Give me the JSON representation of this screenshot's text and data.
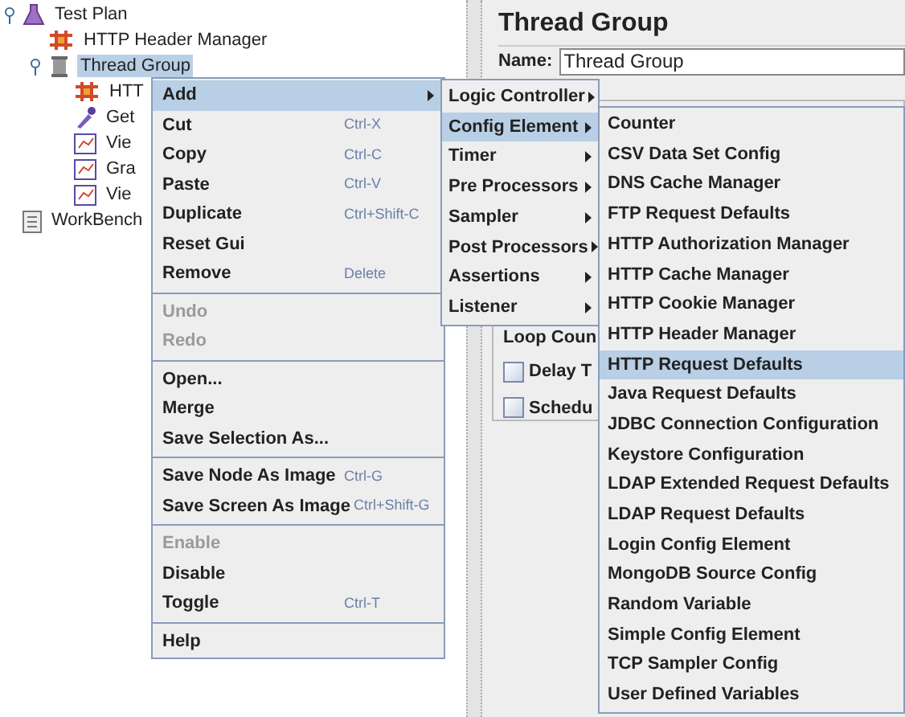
{
  "tree": [
    {
      "label": "Test Plan",
      "kind": "test-plan",
      "expanded": true,
      "selected": false,
      "children": [
        {
          "label": "HTTP Header Manager",
          "kind": "config",
          "selected": false
        },
        {
          "label": "Thread Group",
          "kind": "thread-group",
          "expanded": true,
          "selected": true,
          "children": [
            {
              "label": "HTT",
              "kind": "config",
              "selected": false
            },
            {
              "label": "Get",
              "kind": "sampler",
              "selected": false
            },
            {
              "label": "Vie",
              "kind": "listener",
              "selected": false
            },
            {
              "label": "Gra",
              "kind": "listener",
              "selected": false
            },
            {
              "label": "Vie",
              "kind": "listener",
              "selected": false
            }
          ]
        }
      ]
    },
    {
      "label": "WorkBench",
      "kind": "workbench",
      "selected": false
    }
  ],
  "panel": {
    "title": "Thread Group",
    "name_label": "Name:",
    "name_value": "Thread Group",
    "loop_label": "Loop Coun",
    "checkboxes": [
      {
        "label": "Delay T",
        "checked": false
      },
      {
        "label": "Schedu",
        "checked": false
      }
    ]
  },
  "context_menu": {
    "groups": [
      [
        {
          "label": "Add",
          "kind": "submenu",
          "selected": true,
          "disabled": false
        },
        {
          "label": "Cut",
          "shortcut": "Ctrl-X",
          "kind": "command",
          "selected": false,
          "disabled": false
        },
        {
          "label": "Copy",
          "shortcut": "Ctrl-C",
          "kind": "command",
          "selected": false,
          "disabled": false
        },
        {
          "label": "Paste",
          "shortcut": "Ctrl-V",
          "kind": "command",
          "selected": false,
          "disabled": false
        },
        {
          "label": "Duplicate",
          "shortcut": "Ctrl+Shift-C",
          "kind": "command",
          "selected": false,
          "disabled": false
        },
        {
          "label": "Reset Gui",
          "kind": "command",
          "selected": false,
          "disabled": false
        },
        {
          "label": "Remove",
          "shortcut": "Delete",
          "kind": "command",
          "selected": false,
          "disabled": false
        }
      ],
      [
        {
          "label": "Undo",
          "kind": "command",
          "selected": false,
          "disabled": true
        },
        {
          "label": "Redo",
          "kind": "command",
          "selected": false,
          "disabled": true
        }
      ],
      [
        {
          "label": "Open...",
          "kind": "command",
          "selected": false,
          "disabled": false
        },
        {
          "label": "Merge",
          "kind": "command",
          "selected": false,
          "disabled": false
        },
        {
          "label": "Save Selection As...",
          "kind": "command",
          "selected": false,
          "disabled": false
        }
      ],
      [
        {
          "label": "Save Node As Image",
          "shortcut": "Ctrl-G",
          "kind": "command",
          "selected": false,
          "disabled": false
        },
        {
          "label": "Save Screen As Image",
          "shortcut": "Ctrl+Shift-G",
          "kind": "command",
          "selected": false,
          "disabled": false
        }
      ],
      [
        {
          "label": "Enable",
          "kind": "command",
          "selected": false,
          "disabled": true
        },
        {
          "label": "Disable",
          "kind": "command",
          "selected": false,
          "disabled": false
        },
        {
          "label": "Toggle",
          "shortcut": "Ctrl-T",
          "kind": "command",
          "selected": false,
          "disabled": false
        }
      ],
      [
        {
          "label": "Help",
          "kind": "command",
          "selected": false,
          "disabled": false
        }
      ]
    ]
  },
  "add_submenu": [
    {
      "label": "Logic Controller",
      "selected": false
    },
    {
      "label": "Config Element",
      "selected": true
    },
    {
      "label": "Timer",
      "selected": false
    },
    {
      "label": "Pre Processors",
      "selected": false
    },
    {
      "label": "Sampler",
      "selected": false
    },
    {
      "label": "Post Processors",
      "selected": false
    },
    {
      "label": "Assertions",
      "selected": false
    },
    {
      "label": "Listener",
      "selected": false
    }
  ],
  "config_submenu": [
    {
      "label": "Counter",
      "selected": false
    },
    {
      "label": "CSV Data Set Config",
      "selected": false
    },
    {
      "label": "DNS Cache Manager",
      "selected": false
    },
    {
      "label": "FTP Request Defaults",
      "selected": false
    },
    {
      "label": "HTTP Authorization Manager",
      "selected": false
    },
    {
      "label": "HTTP Cache Manager",
      "selected": false
    },
    {
      "label": "HTTP Cookie Manager",
      "selected": false
    },
    {
      "label": "HTTP Header Manager",
      "selected": false
    },
    {
      "label": "HTTP Request Defaults",
      "selected": true
    },
    {
      "label": "Java Request Defaults",
      "selected": false
    },
    {
      "label": "JDBC Connection Configuration",
      "selected": false
    },
    {
      "label": "Keystore Configuration",
      "selected": false
    },
    {
      "label": "LDAP Extended Request Defaults",
      "selected": false
    },
    {
      "label": "LDAP Request Defaults",
      "selected": false
    },
    {
      "label": "Login Config Element",
      "selected": false
    },
    {
      "label": "MongoDB Source Config",
      "selected": false
    },
    {
      "label": "Random Variable",
      "selected": false
    },
    {
      "label": "Simple Config Element",
      "selected": false
    },
    {
      "label": "TCP Sampler Config",
      "selected": false
    },
    {
      "label": "User Defined Variables",
      "selected": false
    }
  ]
}
